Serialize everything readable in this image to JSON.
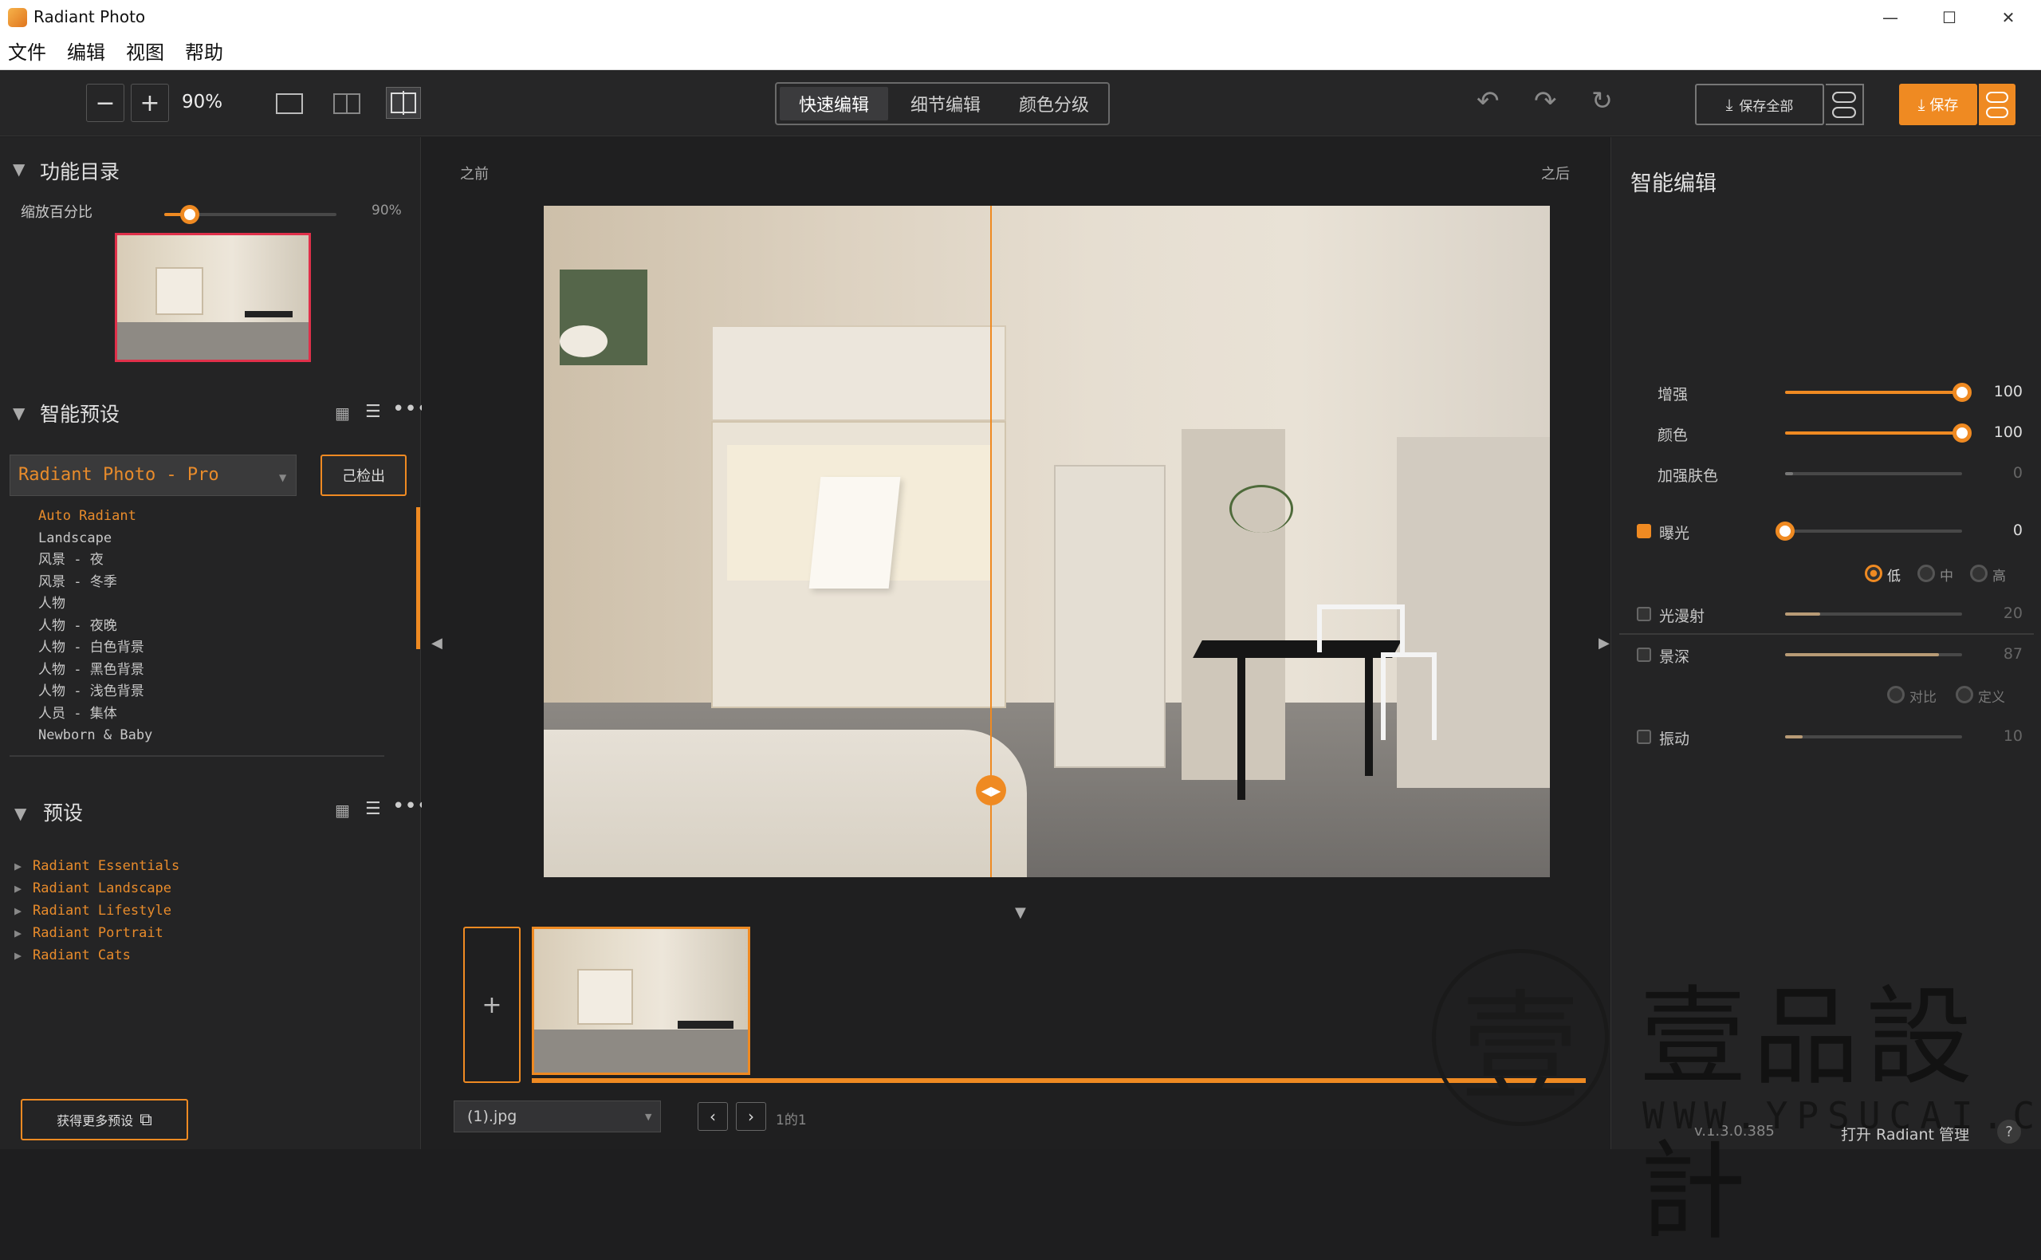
{
  "window": {
    "title": "Radiant Photo",
    "controls": [
      "—",
      "☐",
      "✕"
    ]
  },
  "menu": [
    "文件",
    "编辑",
    "视图",
    "帮助"
  ],
  "toolbar": {
    "zoom_out": "−",
    "zoom_in": "+",
    "zoom": "90%",
    "modes": [
      "快速编辑",
      "细节编辑",
      "颜色分级"
    ],
    "active_mode": "快速编辑",
    "save_all": "保存全部",
    "save": "保存"
  },
  "left": {
    "nav_title": "功能目录",
    "zoom_label": "缩放百分比",
    "zoom_value": "90%",
    "zoom_level": 0.15,
    "smart_title": "智能预设",
    "preset_select": "Radiant Photo - Pro",
    "detected": "己检出",
    "smart_list": [
      "Auto Radiant",
      "Landscape",
      "风景 - 夜",
      "风景 - 冬季",
      "人物",
      "人物 - 夜晚",
      "人物 - 白色背景",
      "人物 - 黑色背景",
      "人物 - 浅色背景",
      "人员 - 集体",
      "Newborn & Baby"
    ],
    "preset_title": "预设",
    "preset_list": [
      "Radiant Essentials",
      "Radiant Landscape",
      "Radiant Lifestyle",
      "Radiant Portrait",
      "Radiant Cats"
    ],
    "more_button": "获得更多预设"
  },
  "center": {
    "before": "之前",
    "after": "之后",
    "file_select": "(1).jpg",
    "page_info": "1的1",
    "add": "+"
  },
  "right": {
    "title": "智能编辑",
    "sliders": [
      {
        "label": "增强",
        "value": "100",
        "level": 1.0,
        "enabled": true
      },
      {
        "label": "颜色",
        "value": "100",
        "level": 1.0,
        "enabled": true
      },
      {
        "label": "加强肤色",
        "value": "0",
        "level": 0.0,
        "enabled": false
      },
      {
        "label": "曝光",
        "value": "0",
        "level": 0.0,
        "enabled": true,
        "checked": true
      },
      {
        "label": "光漫射",
        "value": "20",
        "level": 0.2,
        "enabled": false,
        "checked": false
      },
      {
        "label": "景深",
        "value": "87",
        "level": 0.87,
        "enabled": false,
        "checked": false
      },
      {
        "label": "振动",
        "value": "10",
        "level": 0.1,
        "enabled": false,
        "checked": false
      }
    ],
    "exposure_opts": [
      "低",
      "中",
      "高"
    ],
    "depth_opts": [
      "对比",
      "定义"
    ],
    "version": "v.1.3.0.385",
    "manager": "打开 Radiant 管理"
  },
  "watermark": {
    "text": "壹品設計",
    "url": "WWW.YPSUCAI.COM",
    "seal": "壹"
  },
  "colors": {
    "accent": "#ef8a22",
    "bg": "#242425"
  }
}
